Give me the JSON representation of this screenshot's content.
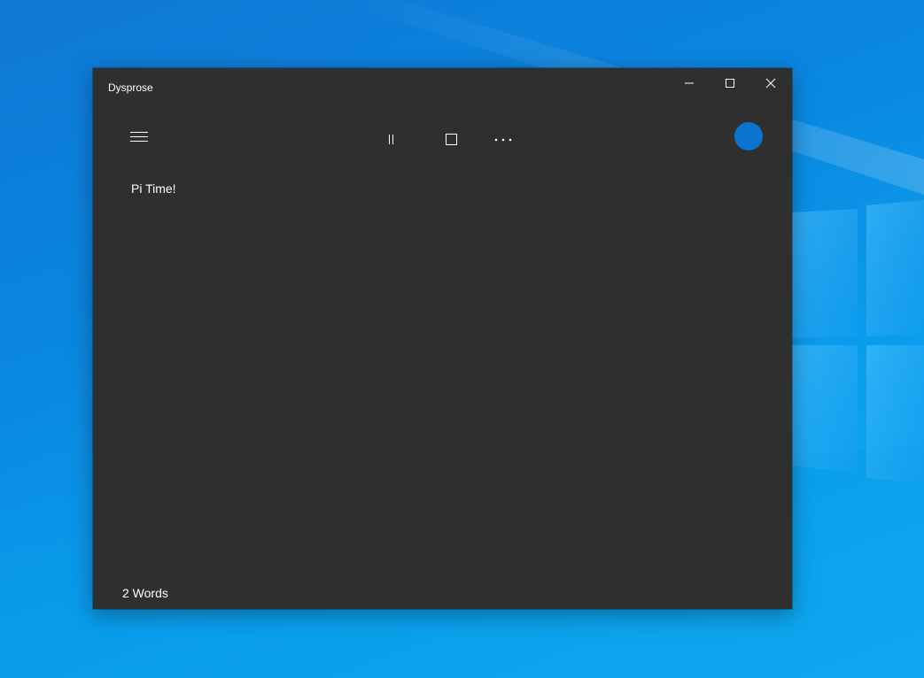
{
  "app": {
    "title": "Dysprose"
  },
  "window_controls": {
    "minimize_icon": "minimize-icon",
    "maximize_icon": "maximize-icon",
    "close_icon": "close-icon"
  },
  "toolbar": {
    "menu_icon": "hamburger-menu-icon",
    "pause_icon": "pause-icon",
    "stop_icon": "stop-icon",
    "more_icon": "more-options-icon",
    "avatar_color": "#0b74d1"
  },
  "document": {
    "text": "Pi Time!"
  },
  "status": {
    "word_count": "2 Words"
  },
  "colors": {
    "window_background": "#2f2f2f",
    "desktop_blue": "#0a86e0",
    "accent": "#0b74d1"
  }
}
